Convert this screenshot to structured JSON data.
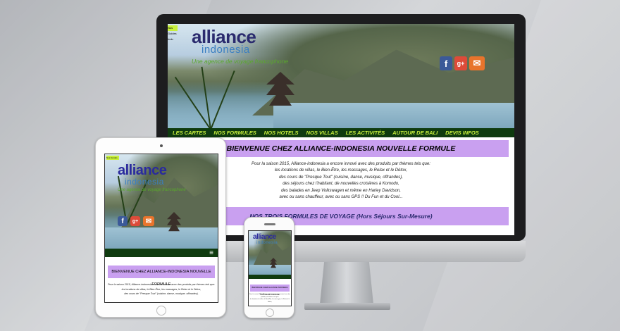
{
  "site": {
    "logo_main": "alliance",
    "logo_sub": "indonesia",
    "tagline": "Une agence de voyage francophone",
    "badge": "Nos Guides Indo"
  },
  "social_icons": [
    "facebook-icon",
    "google-plus-icon",
    "mail-icon"
  ],
  "social_glyphs": {
    "facebook": "f",
    "googleplus": "g+",
    "mail": "✉"
  },
  "nav": {
    "items": [
      "LES CARTES",
      "NOS FORMULES",
      "NOS HOTELS",
      "NOS VILLAS",
      "LES ACTIVITÉS",
      "AUTOUR DE BALI",
      "DEVIS INFOS"
    ],
    "menu_glyph": "≡"
  },
  "desktop": {
    "welcome": "BIENVENUE CHEZ ALLIANCE-INDONESIA NOUVELLE FORMULE",
    "intro_lines": [
      "Pour la saison 2015, Alliance-indonesia a encore innové avec des produits par thèmes tels que:",
      "les locations de villas, le Bien-Être, les massages, le Relax et le Détox,",
      "des cours de \"Presque Tout\" (cuisine, danse, musique, offrandes),",
      "des séjours chez l'habitant, de nouvelles croisières à Komodo,",
      "des balades en Jeep Volkswagen et même en Harley Davidson,",
      "avec ou sans chauffeur, avec ou sans GPS !! Du Fun et du Cool..."
    ],
    "formules": "NOS TROIS FORMULES DE VOYAGE (Hors Séjours Sur-Mesure)"
  },
  "tablet": {
    "welcome": "BIENVENUE CHEZ ALLIANCE-INDONESIA NOUVELLE FORMULE",
    "intro_lines": [
      "Pour la saison 2015, Alliance-indonesia a encore innové avec des produits par thèmes tels que:",
      "les locations de villas, le Bien-Être, les massages, le Relax et le Détox,",
      "des cours de \"Presque Tout\" (cuisine, danse, musique, offrandes),"
    ]
  },
  "phone": {
    "welcome": "BIENVENUE CHEZ ALLIANCE-INDONESIA NOUVELLE FORMULE",
    "intro_lines": [
      "Pour la saison 2015, Alliance-indonesia a encore innové avec des produits par thèmes tels que:",
      "les locations de villas, le Bien-Être, les massages, le Relax et le Détox,"
    ]
  },
  "colors": {
    "nav_bg": "#0f3b0f",
    "nav_text": "#c8f03c",
    "welcome_bg": "#c9a0f0",
    "logo_blue": "#2a2a6e"
  }
}
